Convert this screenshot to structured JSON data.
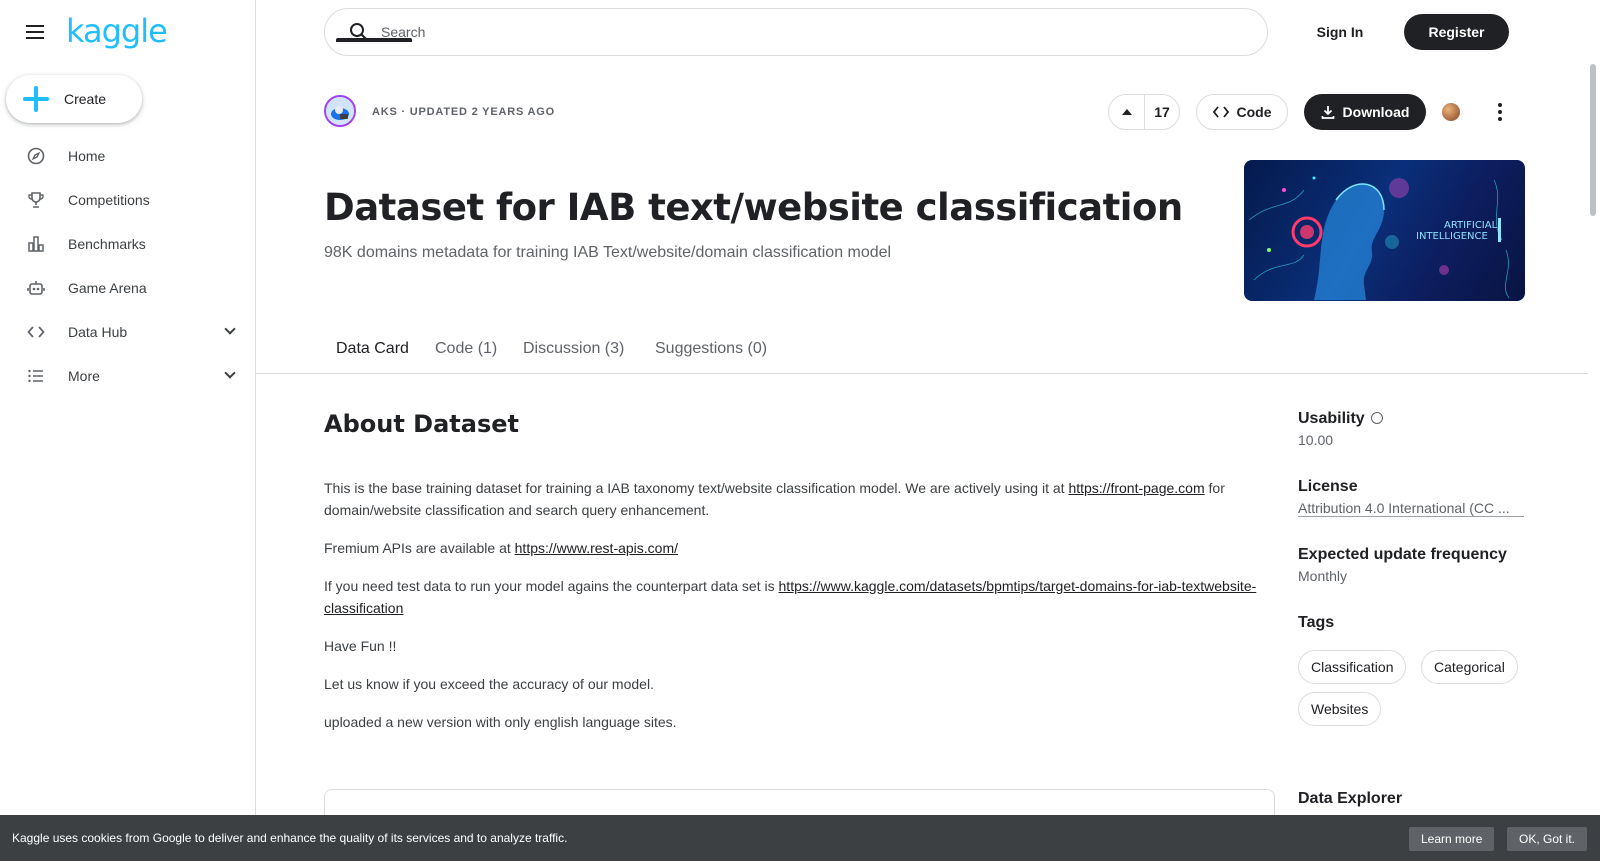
{
  "sidebar": {
    "logo": "kaggle",
    "create_label": "Create",
    "items": [
      {
        "label": "Home",
        "icon": "compass-icon"
      },
      {
        "label": "Competitions",
        "icon": "trophy-icon"
      },
      {
        "label": "Benchmarks",
        "icon": "bar-chart-icon"
      },
      {
        "label": "Game Arena",
        "icon": "robot-icon"
      },
      {
        "label": "Data Hub",
        "icon": "code-brackets-icon"
      },
      {
        "label": "More",
        "icon": "list-icon"
      }
    ]
  },
  "header": {
    "search_placeholder": "Search",
    "signin_label": "Sign In",
    "register_label": "Register"
  },
  "dataset": {
    "owner_meta": "AKS · UPDATED 2 YEARS AGO",
    "votes": "17",
    "code_label": "Code",
    "download_label": "Download",
    "title": "Dataset for IAB text/website classification",
    "subtitle": "98K domains metadata for training IAB Text/website/domain classification model",
    "cover_text_1": "ARTIFICIAL",
    "cover_text_2": "INTELLIGENCE"
  },
  "tabs": [
    "Data Card",
    "Code (1)",
    "Discussion (3)",
    "Suggestions (0)"
  ],
  "about": {
    "title": "About Dataset",
    "p1_text": "This is the base training dataset for training a IAB taxonomy text/website classification model. We are actively using it at ",
    "p1_link": "https://front-page.com",
    "p1_tail": " for domain/website classification and search query enhancement.",
    "p2_text": "Fremium APIs are available at ",
    "p2_link": "https://www.rest-apis.com/",
    "p3_text": "If you need test data to run your model agains the counterpart data set is ",
    "p3_link": "https://www.kaggle.com/datasets/bpmtips/target-domains-for-iab-textwebsite-classification",
    "p4": "Have Fun !!",
    "p5": "Let us know if you exceed the accuracy of our model.",
    "p6": "uploaded a new version with only english language sites."
  },
  "meta": {
    "usability_label": "Usability",
    "usability_value": "10.00",
    "license_label": "License",
    "license_value": "Attribution 4.0 International (CC ...",
    "frequency_label": "Expected update frequency",
    "frequency_value": "Monthly",
    "tags_label": "Tags",
    "tags": [
      "Classification",
      "Categorical",
      "Websites"
    ],
    "explorer_label": "Data Explorer"
  },
  "cookie": {
    "text": "Kaggle uses cookies from Google to deliver and enhance the quality of its services and to analyze traffic.",
    "learn_more": "Learn more",
    "ok": "OK, Got it."
  },
  "colors": {
    "brand": "#20beff",
    "dark": "#202124",
    "muted": "#5f6368"
  }
}
